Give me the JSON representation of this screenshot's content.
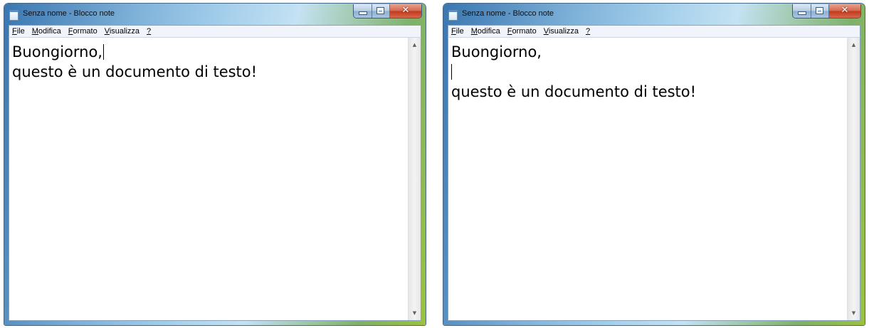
{
  "windows": [
    {
      "title": "Senza nome - Blocco note",
      "menu": [
        {
          "underlined": "F",
          "rest": "ile"
        },
        {
          "underlined": "M",
          "rest": "odifica"
        },
        {
          "underlined": "F",
          "rest": "ormato",
          "prefix": ""
        },
        {
          "underlined": "V",
          "rest": "isualizza"
        },
        {
          "underlined": "?",
          "rest": ""
        }
      ],
      "lines": [
        "Buongiorno,",
        "questo è un documento di testo!"
      ],
      "caret": "after-line-1"
    },
    {
      "title": "Senza nome - Blocco note",
      "menu": [
        {
          "underlined": "F",
          "rest": "ile"
        },
        {
          "underlined": "M",
          "rest": "odifica"
        },
        {
          "underlined": "F",
          "rest": "ormato"
        },
        {
          "underlined": "V",
          "rest": "isualizza"
        },
        {
          "underlined": "?",
          "rest": ""
        }
      ],
      "lines": [
        "Buongiorno,",
        "",
        "questo è un documento di testo!"
      ],
      "caret": "on-empty-line-2"
    }
  ],
  "menu_labels": {
    "file": "File",
    "modifica": "Modifica",
    "formato": "Formato",
    "visualizza": "Visualizza",
    "help": "?"
  },
  "icons": [
    "notepad-app-icon",
    "minimize-icon",
    "maximize-icon",
    "close-icon",
    "scroll-up-icon",
    "scroll-down-icon"
  ],
  "colors": {
    "close_button": "#c13a1c",
    "title_text": "#101010",
    "editor_background": "#ffffff"
  }
}
